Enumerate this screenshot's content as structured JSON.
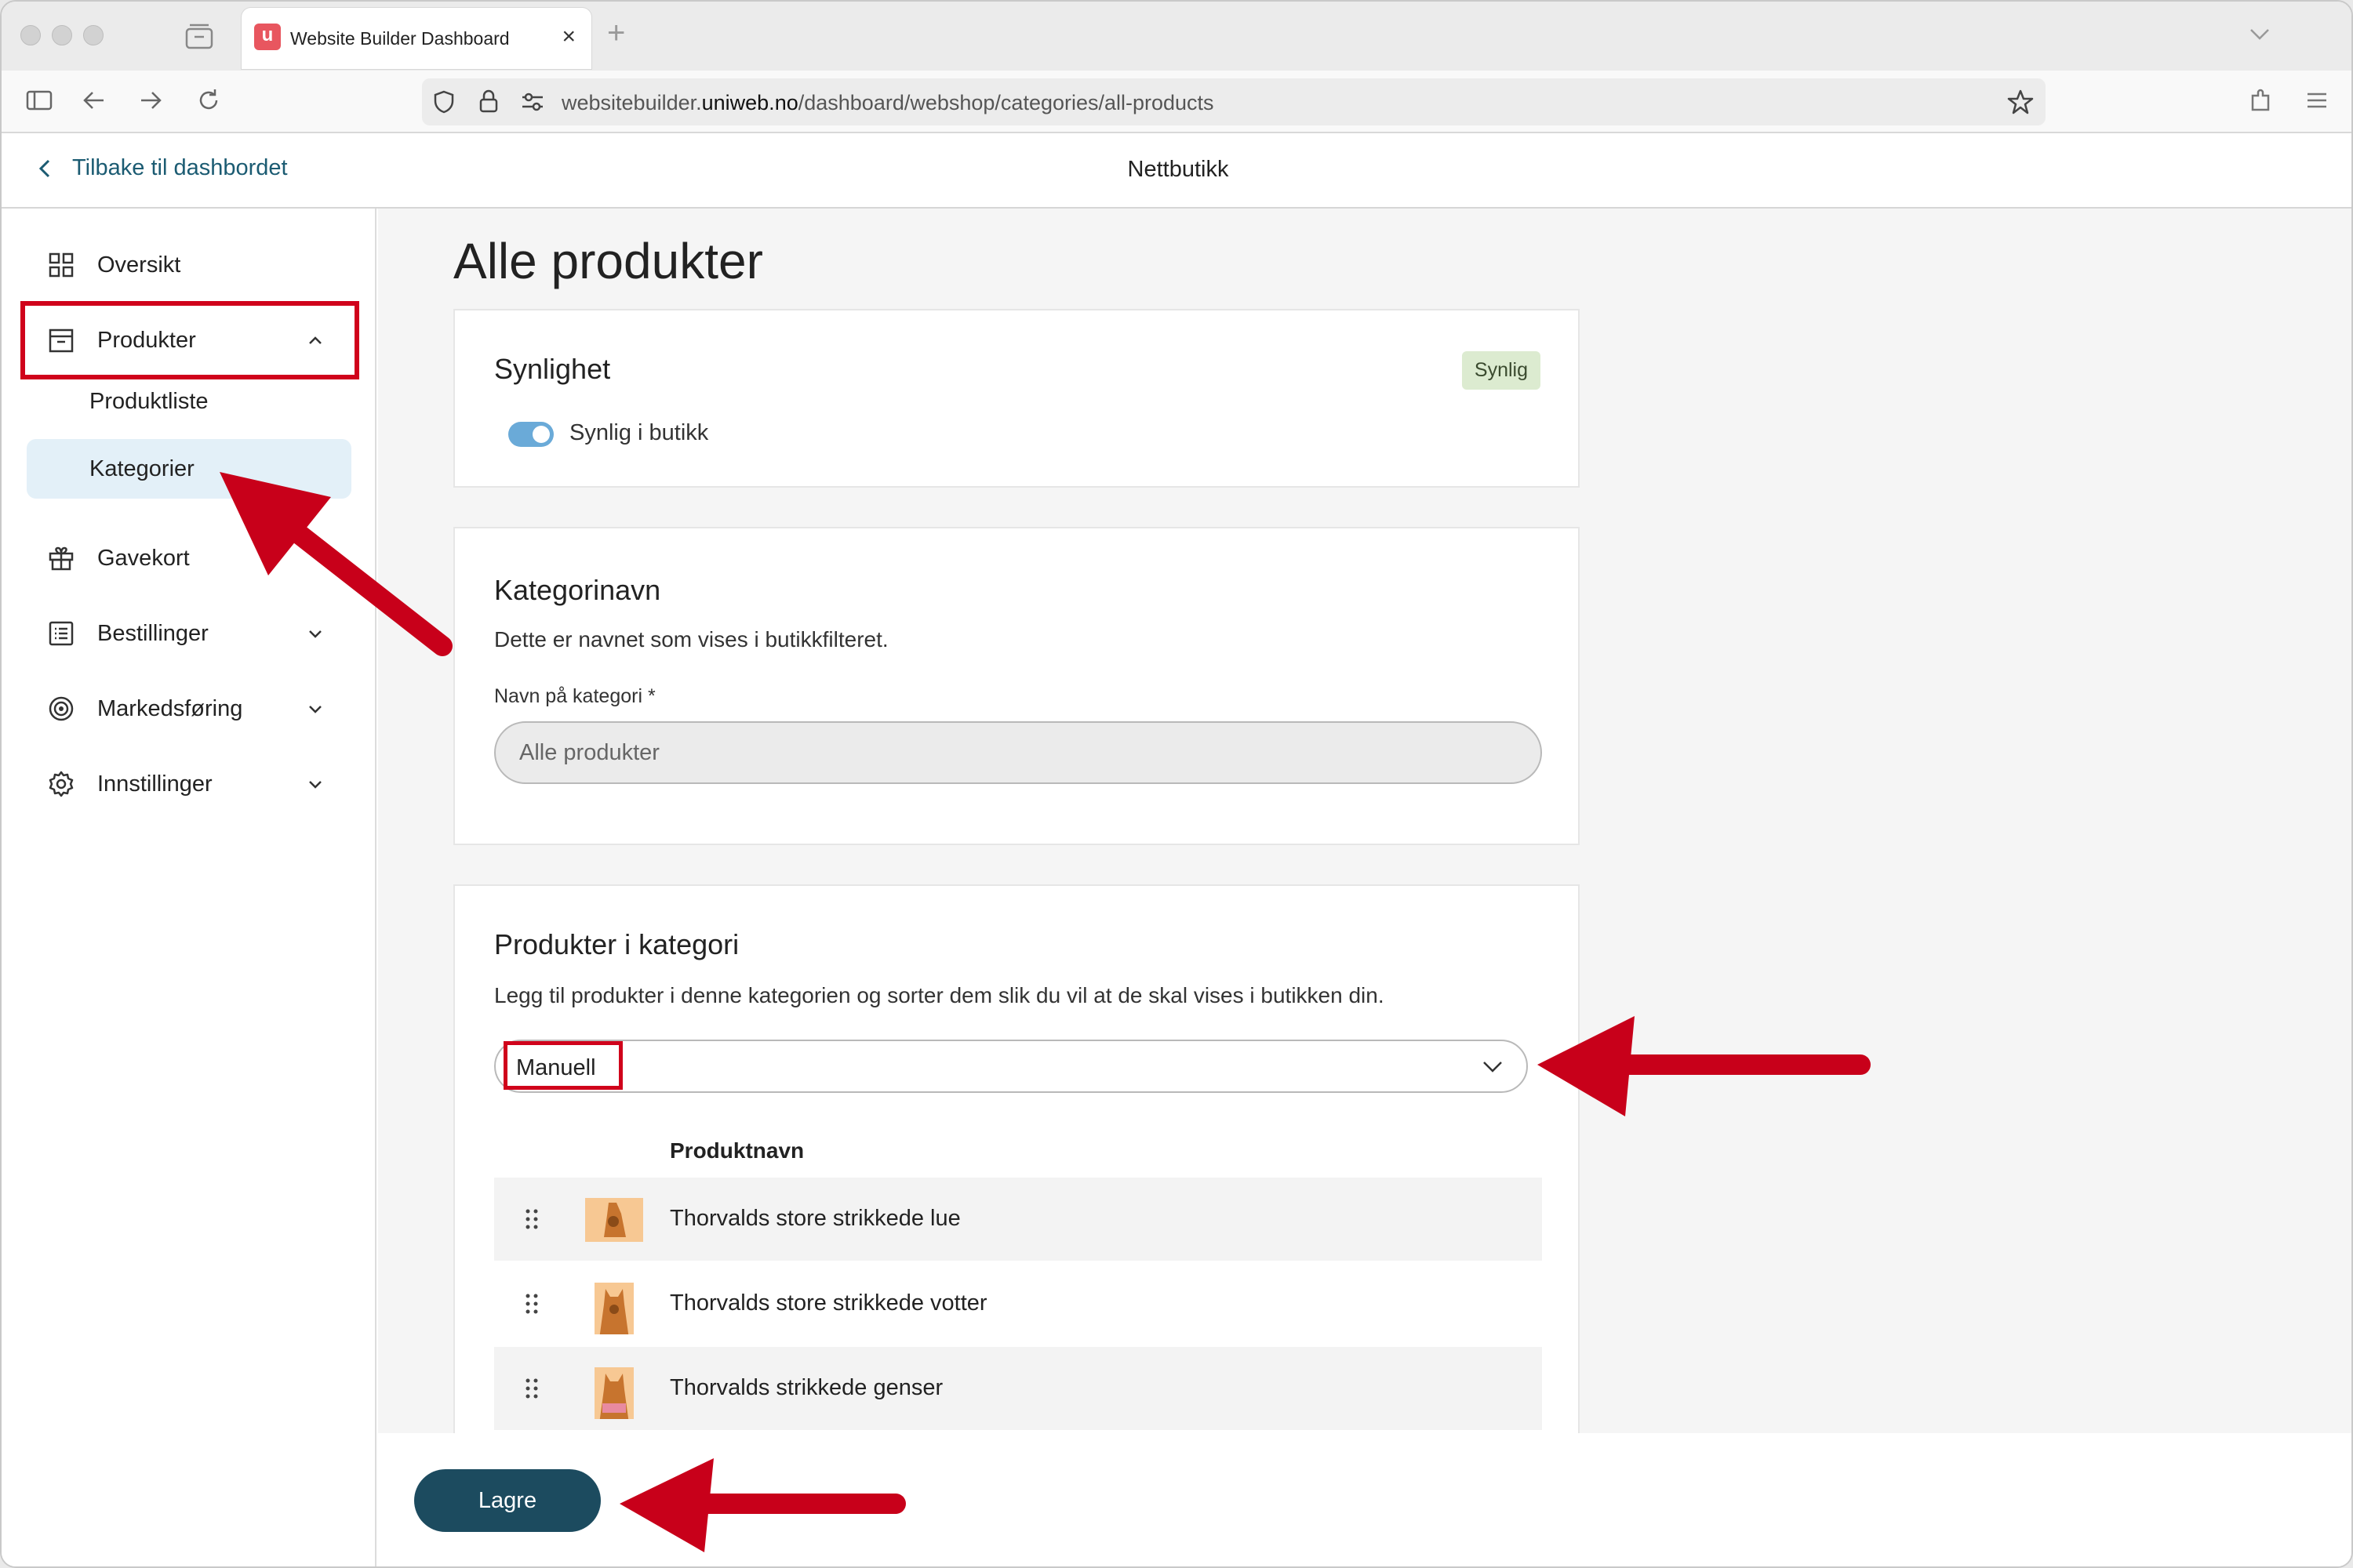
{
  "browser": {
    "tab_title": "Website Builder Dashboard",
    "tab_favicon_letter": "u",
    "tab_close": "×",
    "new_tab": "+",
    "url_prefix": "websitebuilder.",
    "url_domain": "uniweb.no",
    "url_path": "/dashboard/webshop/categories/all-products"
  },
  "header": {
    "back_label": "Tilbake til dashbordet",
    "title": "Nettbutikk"
  },
  "sidebar": {
    "items": [
      {
        "label": "Oversikt",
        "icon": "grid-icon"
      },
      {
        "label": "Produkter",
        "icon": "archive-box-icon",
        "expanded": true
      },
      {
        "label": "Gavekort",
        "icon": "gift-icon"
      },
      {
        "label": "Bestillinger",
        "icon": "list-icon"
      },
      {
        "label": "Markedsføring",
        "icon": "target-icon"
      },
      {
        "label": "Innstillinger",
        "icon": "gear-icon"
      }
    ],
    "sub_items": [
      {
        "label": "Produktliste"
      },
      {
        "label": "Kategorier",
        "active": true
      }
    ]
  },
  "main": {
    "page_title": "Alle produkter",
    "visibility": {
      "heading": "Synlighet",
      "badge": "Synlig",
      "toggle_label": "Synlig i butikk",
      "toggle_on": true
    },
    "category_name": {
      "heading": "Kategorinavn",
      "description": "Dette er navnet som vises i butikkfilteret.",
      "field_label": "Navn på kategori *",
      "field_value": "Alle produkter"
    },
    "products": {
      "heading": "Produkter i kategori",
      "description": "Legg til produkter i denne kategorien og sorter dem slik du vil at de skal vises i butikken din.",
      "sort_value": "Manuell",
      "column_header": "Produktnavn",
      "rows": [
        {
          "name": "Thorvalds store strikkede lue"
        },
        {
          "name": "Thorvalds store strikkede votter"
        },
        {
          "name": "Thorvalds strikkede genser"
        }
      ]
    },
    "save_label": "Lagre"
  },
  "colors": {
    "accent": "#1c4b5f",
    "link": "#1b5b72",
    "annotation": "#d0021b",
    "badge_bg": "#dcebd0",
    "active_bg": "#e3f0f8",
    "toggle": "#6aaad8"
  }
}
